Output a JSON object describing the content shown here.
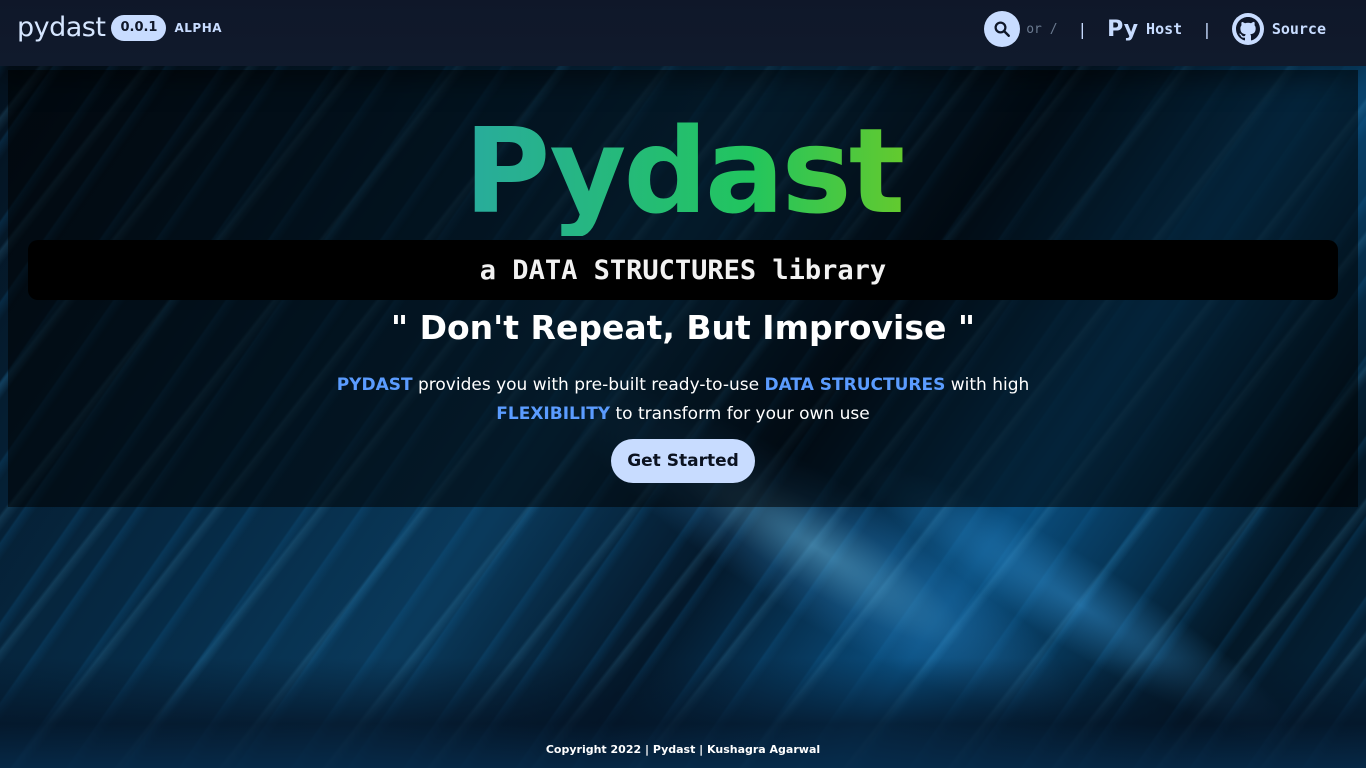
{
  "header": {
    "brand": "pydast",
    "version": "0.0.1",
    "stage": "ALPHA",
    "search_hint": "or /",
    "separator": "|",
    "host_mark": "Py",
    "host_label": "Host",
    "source_label": "Source"
  },
  "hero": {
    "title": "Pydast",
    "tagline": "a DATA STRUCTURES library",
    "motto": "\" Don't Repeat, But Improvise \"",
    "desc": {
      "hl1": "PYDAST",
      "t1": " provides you with pre-built ready-to-use ",
      "hl2": "DATA STRUCTURES",
      "t2": " with high",
      "hl3": "FLEXIBILITY",
      "t3": " to transform for your own use"
    },
    "cta_label": "Get Started"
  },
  "footer": {
    "copyright": "Copyright 2022 | Pydast | Kushagra Agarwal"
  },
  "colors": {
    "accent": "#5b9cff",
    "pill": "#c8dcff",
    "header_bg": "#0f1729"
  },
  "icons": {
    "search": "search-icon",
    "github": "github-icon"
  },
  "page_load_progress": 0.2
}
